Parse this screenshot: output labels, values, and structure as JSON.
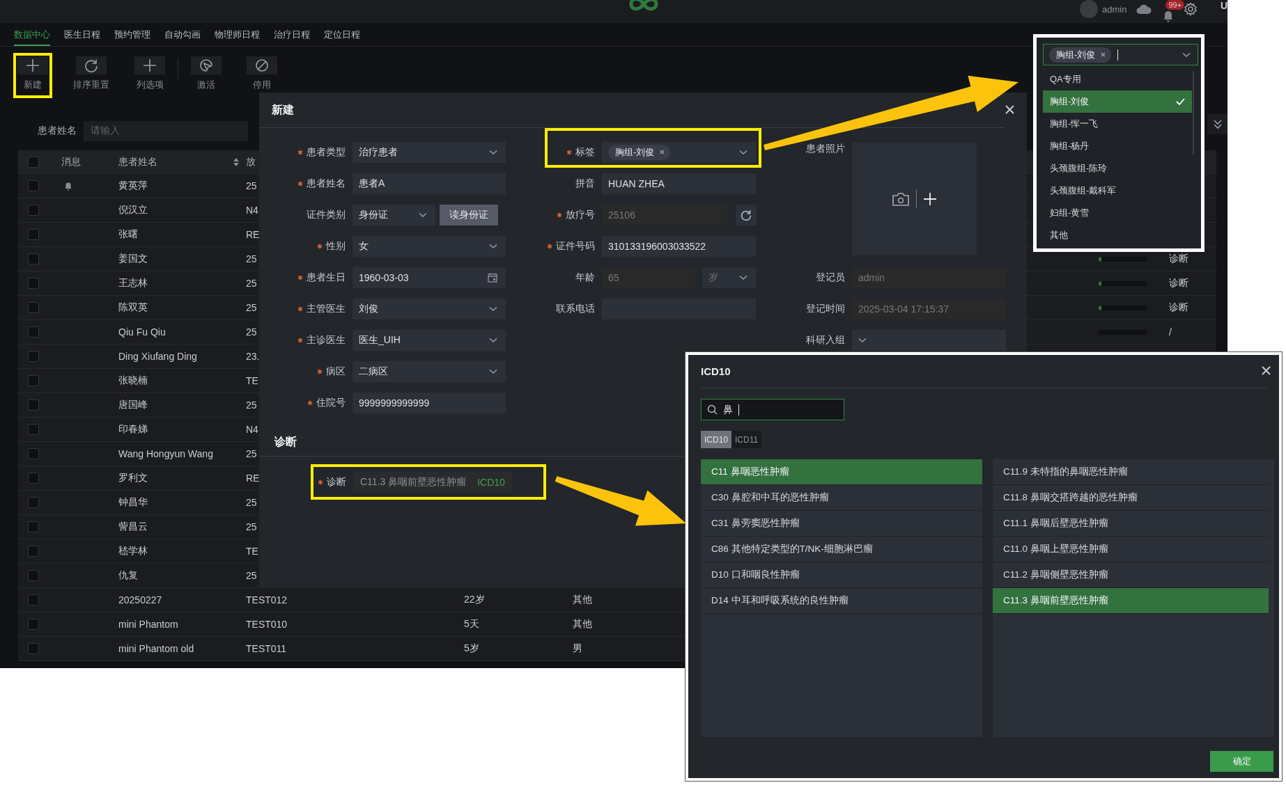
{
  "top_bar": {
    "user": "admin",
    "badge": "99+",
    "edge_text": "U"
  },
  "nav_tabs": [
    {
      "label": "数据中心",
      "selected": true
    },
    {
      "label": "医生日程",
      "selected": false
    },
    {
      "label": "预约管理",
      "selected": false
    },
    {
      "label": "自动勾画",
      "selected": false
    },
    {
      "label": "物理师日程",
      "selected": false
    },
    {
      "label": "治疗日程",
      "selected": false
    },
    {
      "label": "定位日程",
      "selected": false
    }
  ],
  "toolbar": [
    {
      "kind": "add",
      "label": "新建",
      "highlighted": true
    },
    {
      "kind": "reset",
      "label": "排序重置",
      "highlighted": false
    },
    {
      "kind": "add",
      "label": "列选项",
      "highlighted": false
    },
    {
      "kind": "activate",
      "label": "激活",
      "highlighted": false
    },
    {
      "kind": "disable",
      "label": "停用",
      "highlighted": false
    }
  ],
  "filter": {
    "label": "患者姓名",
    "placeholder": "请输入"
  },
  "table": {
    "all_checked": false,
    "columns": [
      "消息",
      "患者姓名",
      "放"
    ],
    "rows": [
      {
        "checked": false,
        "message": true,
        "name": "黄英萍",
        "column_3": "25"
      },
      {
        "checked": false,
        "message": false,
        "name": "倪汉立",
        "column_3": "N4"
      },
      {
        "checked": false,
        "message": false,
        "name": "张曙",
        "column_3": "RE"
      },
      {
        "checked": false,
        "message": false,
        "name": "姜国文",
        "column_3": "25",
        "level": 0.05,
        "column_8": "诊断"
      },
      {
        "checked": false,
        "message": false,
        "name": "王志林",
        "column_3": "25",
        "level": 0.05,
        "column_8": "诊断"
      },
      {
        "checked": false,
        "message": false,
        "name": "陈双英",
        "column_3": "25",
        "level": 0.05,
        "column_8": "诊断"
      },
      {
        "checked": false,
        "message": false,
        "name": "Qiu Fu Qiu",
        "column_3": "25",
        "level": 0,
        "column_8": "/"
      },
      {
        "checked": false,
        "message": false,
        "name": "Ding Xiufang Ding",
        "column_3": "23."
      },
      {
        "checked": false,
        "message": false,
        "name": "张晓楠",
        "column_3": "TE"
      },
      {
        "checked": false,
        "message": false,
        "name": "唐国峰",
        "column_3": "25"
      },
      {
        "checked": false,
        "message": false,
        "name": "印春娣",
        "column_3": "N4"
      },
      {
        "checked": false,
        "message": false,
        "name": "Wang Hongyun Wang",
        "column_3": "25"
      },
      {
        "checked": false,
        "message": false,
        "name": "罗利文",
        "column_3": "RE"
      },
      {
        "checked": false,
        "message": false,
        "name": "钟昌华",
        "column_3": "25"
      },
      {
        "checked": false,
        "message": false,
        "name": "訾昌云",
        "column_3": "25"
      },
      {
        "checked": false,
        "message": false,
        "name": "嵇学林",
        "column_3": "TE"
      },
      {
        "checked": false,
        "message": false,
        "name": "仇复",
        "column_3": "25"
      },
      {
        "checked": false,
        "message": false,
        "name": "20250227",
        "column_3": "TEST012",
        "column_4": "22岁",
        "column_5": "其他"
      },
      {
        "checked": false,
        "message": false,
        "name": "mini Phantom",
        "column_3": "TEST010",
        "column_4": "5天",
        "column_5": "其他"
      },
      {
        "checked": false,
        "message": false,
        "name": "mini Phantom old",
        "column_3": "TEST011",
        "column_4": "5岁",
        "column_5": "男"
      }
    ]
  },
  "modal": {
    "title": "新建",
    "left": [
      {
        "kind": "select",
        "label": "患者类型",
        "required": true,
        "value": "治疗患者"
      },
      {
        "kind": "text",
        "label": "患者姓名",
        "required": true,
        "value": "患者A"
      },
      {
        "kind": "select_button",
        "label": "证件类别",
        "required": false,
        "value": "身份证",
        "button": "读身份证"
      },
      {
        "kind": "select",
        "label": "性别",
        "required": true,
        "value": "女"
      },
      {
        "kind": "date",
        "label": "患者生日",
        "required": true,
        "value": "1960-03-03"
      },
      {
        "kind": "select",
        "label": "主管医生",
        "required": true,
        "value": "刘俊"
      },
      {
        "kind": "select",
        "label": "主诊医生",
        "required": true,
        "value": "医生_UIH"
      },
      {
        "kind": "select",
        "label": "病区",
        "required": true,
        "value": "二病区"
      },
      {
        "kind": "text",
        "label": "住院号",
        "required": true,
        "value": "9999999999999"
      }
    ],
    "middle": [
      {
        "kind": "tags",
        "label": "标签",
        "required": true,
        "tags": [
          "胸组-刘俊"
        ],
        "highlighted": true
      },
      {
        "kind": "text",
        "label": "拼音",
        "required": false,
        "value": "HUAN ZHEA"
      },
      {
        "kind": "readonly_refresh",
        "label": "放疗号",
        "required": true,
        "value": "25106"
      },
      {
        "kind": "text",
        "label": "证件号码",
        "required": true,
        "value": "310133196003033522"
      },
      {
        "kind": "readonly_unit",
        "label": "年龄",
        "required": false,
        "value": "65",
        "unit": "岁"
      },
      {
        "kind": "text",
        "label": "联系电话",
        "required": false
      }
    ],
    "right": [
      {
        "kind": "photo",
        "label": "患者照片",
        "required": false
      },
      {
        "kind": "readonly",
        "label": "登记员",
        "required": false,
        "value": "admin"
      },
      {
        "kind": "readonly",
        "label": "登记时间",
        "required": false,
        "value": "2025-03-04 17:15:37"
      },
      {
        "kind": "select",
        "label": "科研入组",
        "required": false
      }
    ],
    "section_title": "诊断",
    "diagnosis": {
      "label": "诊断",
      "required": true,
      "value": "C11.3 鼻咽前壁恶性肿瘤",
      "code_system": "ICD10",
      "highlighted": true
    }
  },
  "tag_dropdown": {
    "tags": [
      "胸组-刘俊"
    ],
    "options": [
      {
        "label": "QA专用",
        "selected": false
      },
      {
        "label": "胸组-刘俊",
        "selected": true
      },
      {
        "label": "胸组-恽一飞",
        "selected": false
      },
      {
        "label": "胸组-杨丹",
        "selected": false
      },
      {
        "label": "头颈腹组-陈玲",
        "selected": false
      },
      {
        "label": "头颈腹组-戴科军",
        "selected": false
      },
      {
        "label": "妇组-黄雪",
        "selected": false
      },
      {
        "label": "其他",
        "selected": false
      }
    ]
  },
  "icd_dialog": {
    "title": "ICD10",
    "search": {
      "value": "鼻"
    },
    "tabs": [
      {
        "label": "ICD10",
        "selected": true
      },
      {
        "label": "ICD11",
        "selected": false
      }
    ],
    "left_list": [
      {
        "label": "C11 鼻咽恶性肿瘤",
        "selected": true
      },
      {
        "label": "C30 鼻腔和中耳的恶性肿瘤",
        "selected": false
      },
      {
        "label": "C31 鼻旁窦恶性肿瘤",
        "selected": false
      },
      {
        "label": "C86 其他特定类型的T/NK-细胞淋巴瘤",
        "selected": false
      },
      {
        "label": "D10 口和咽良性肿瘤",
        "selected": false
      },
      {
        "label": "D14 中耳和呼吸系统的良性肿瘤",
        "selected": false
      }
    ],
    "right_list": [
      {
        "label": "C11.9 未特指的鼻咽恶性肿瘤",
        "selected": false
      },
      {
        "label": "C11.8 鼻咽交搭跨越的恶性肿瘤",
        "selected": false
      },
      {
        "label": "C11.1 鼻咽后壁恶性肿瘤",
        "selected": false
      },
      {
        "label": "C11.0 鼻咽上壁恶性肿瘤",
        "selected": false
      },
      {
        "label": "C11.2 鼻咽侧壁恶性肿瘤",
        "selected": false
      },
      {
        "label": "C11.3 鼻咽前壁恶性肿瘤",
        "selected": true
      }
    ],
    "confirm": "确定"
  }
}
